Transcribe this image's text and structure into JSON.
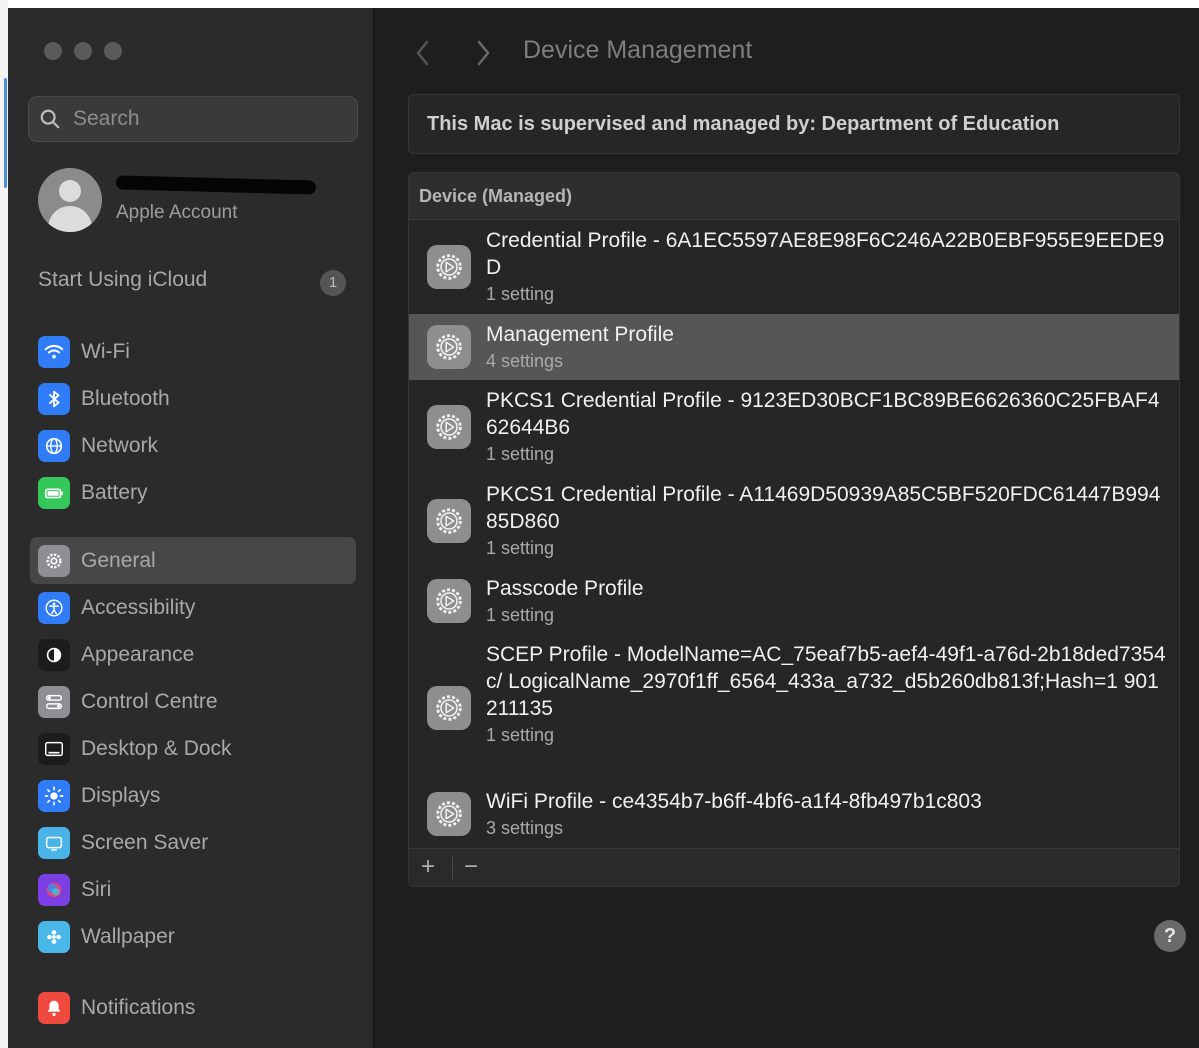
{
  "sidebar": {
    "search_placeholder": "Search",
    "account_subtitle": "Apple Account",
    "icloud_label": "Start Using iCloud",
    "icloud_badge": "1",
    "items": [
      {
        "label": "Wi-Fi",
        "icon": "wifi-icon",
        "color": "#2f7cf6"
      },
      {
        "label": "Bluetooth",
        "icon": "bluetooth-icon",
        "color": "#2f7cf6"
      },
      {
        "label": "Network",
        "icon": "globe-icon",
        "color": "#2f7cf6"
      },
      {
        "label": "Battery",
        "icon": "battery-icon",
        "color": "#34c759"
      },
      {
        "label": "General",
        "icon": "gear-icon",
        "color": "#8e8e93",
        "selected": true
      },
      {
        "label": "Accessibility",
        "icon": "accessibility-icon",
        "color": "#2f7cf6"
      },
      {
        "label": "Appearance",
        "icon": "appearance-icon",
        "color": "#1c1c1c"
      },
      {
        "label": "Control Centre",
        "icon": "control-centre-icon",
        "color": "#8e8e93"
      },
      {
        "label": "Desktop & Dock",
        "icon": "dock-icon",
        "color": "#1c1c1c"
      },
      {
        "label": "Displays",
        "icon": "sun-icon",
        "color": "#2f7cf6"
      },
      {
        "label": "Screen Saver",
        "icon": "screen-saver-icon",
        "color": "#4ab3e8"
      },
      {
        "label": "Siri",
        "icon": "siri-icon",
        "color": "#7b3fe4"
      },
      {
        "label": "Wallpaper",
        "icon": "wallpaper-icon",
        "color": "#49b8e8"
      },
      {
        "label": "Notifications",
        "icon": "bell-icon",
        "color": "#f04a3e"
      }
    ]
  },
  "main": {
    "title": "Device Management",
    "banner": "This Mac is supervised and managed by: Department of Education",
    "section_header": "Device (Managed)",
    "profiles": [
      {
        "name": "Credential Profile - 6A1EC5597AE8E98F6C246A22B0EBF955E9EEDE9D",
        "settings": "1 setting"
      },
      {
        "name": "Management Profile",
        "settings": "4 settings",
        "selected": true
      },
      {
        "name": "PKCS1 Credential Profile - 9123ED30BCF1BC89BE6626360C25FBAF462644B6",
        "settings": "1 setting"
      },
      {
        "name": "PKCS1 Credential Profile - A11469D50939A85C5BF520FDC61447B99485D860",
        "settings": "1 setting"
      },
      {
        "name": "Passcode Profile",
        "settings": "1 setting"
      },
      {
        "name": "SCEP Profile - ModelName=AC_75eaf7b5-aef4-49f1-a76d-2b18ded7354c/ LogicalName_2970f1ff_6564_433a_a732_d5b260db813f;Hash=1 901211135",
        "settings": "1 setting"
      },
      {
        "name": "WiFi Profile - ce4354b7-b6ff-4bf6-a1f4-8fb497b1c803",
        "settings": "3 settings"
      }
    ],
    "add_label": "+",
    "remove_label": "−",
    "help_label": "?"
  }
}
